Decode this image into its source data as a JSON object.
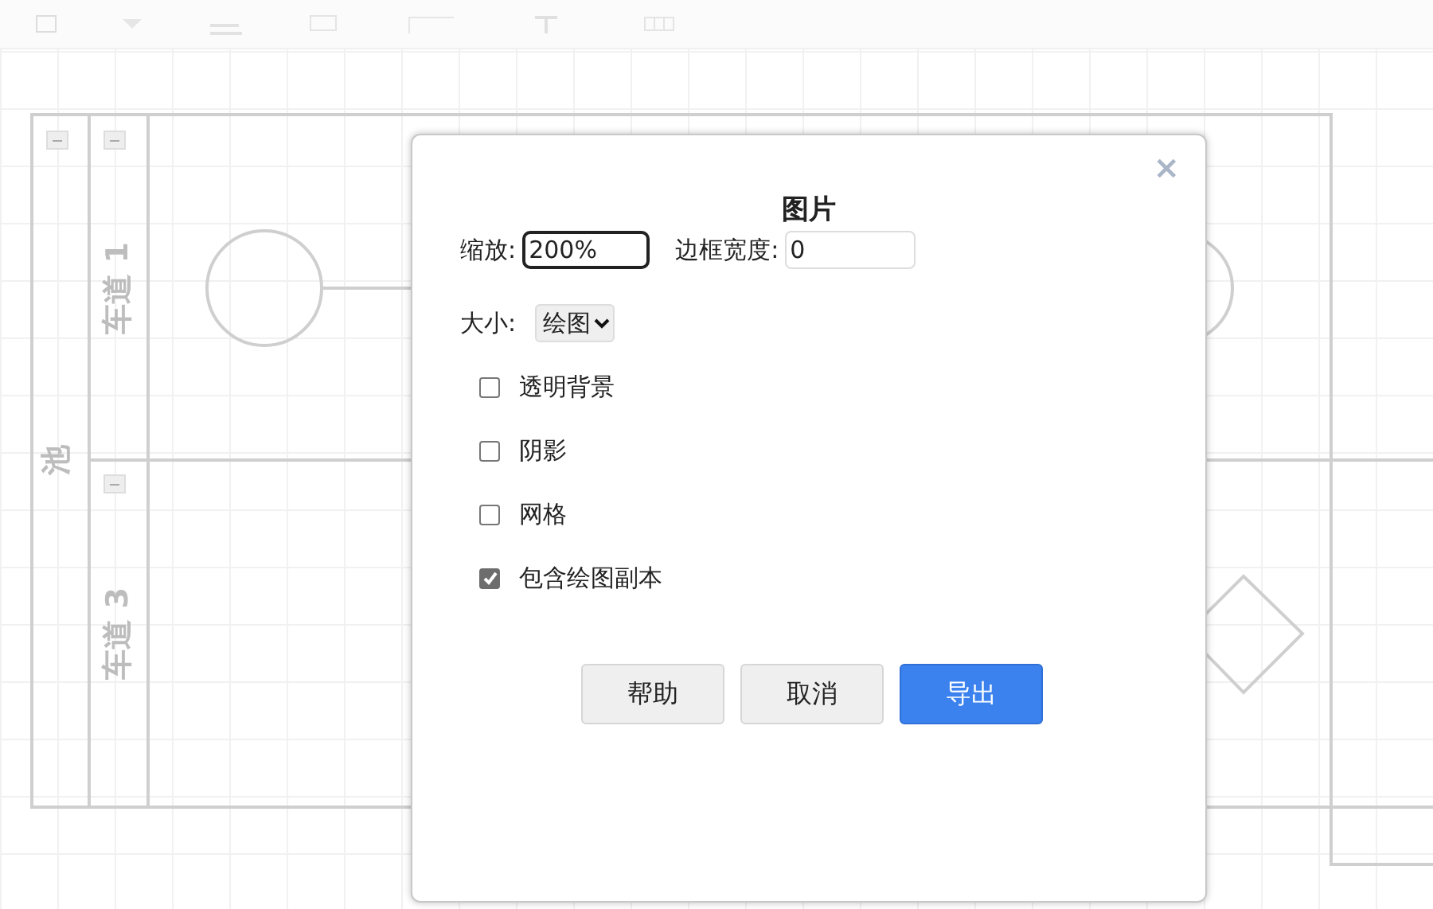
{
  "diagram": {
    "pool": {
      "label": "池"
    },
    "lanes": [
      {
        "label": "车道 1"
      },
      {
        "label": "车道 3"
      }
    ]
  },
  "dialog": {
    "close": "×",
    "title": "图片",
    "scale": {
      "label": "缩放:",
      "value": "200%",
      "focused": true
    },
    "border_width": {
      "label": "边框宽度:",
      "value": "0",
      "focused": false
    },
    "size": {
      "label": "大小:",
      "value": "绘图"
    },
    "options": [
      {
        "label": "透明背景",
        "checked": false
      },
      {
        "label": "阴影",
        "checked": false
      },
      {
        "label": "网格",
        "checked": false
      },
      {
        "label": "包含绘图副本",
        "checked": true
      }
    ],
    "buttons": [
      {
        "label": "帮助",
        "kind": "secondary"
      },
      {
        "label": "取消",
        "kind": "secondary"
      },
      {
        "label": "导出",
        "kind": "primary"
      }
    ]
  }
}
